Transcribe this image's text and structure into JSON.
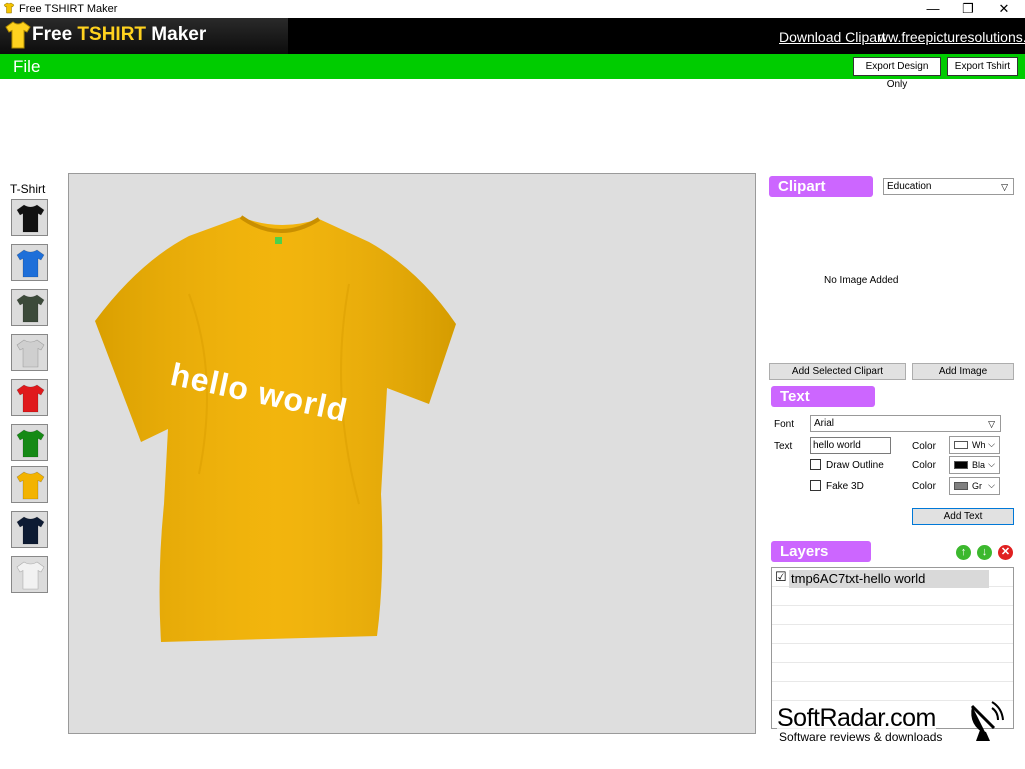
{
  "window": {
    "title": "Free TSHIRT Maker",
    "controls": {
      "minimize": "—",
      "maximize": "❐",
      "close": "✕"
    }
  },
  "banner": {
    "brand_free": "Free ",
    "brand_tshirt": "TSHIRT",
    "brand_maker": " Maker",
    "link_clipart": "Download Clipart",
    "link_site": "ww.freepicturesolutions.co"
  },
  "menu": {
    "file": "File",
    "export_design": "Export Design Only",
    "export_tshirt": "Export Tshirt"
  },
  "left": {
    "label": "T-Shirt",
    "swatch_colors": [
      "#111111",
      "#1e6fd9",
      "#3c4a3a",
      "#cfcfcf",
      "#e0191c",
      "#168a16",
      "#f3b300",
      "#0d1b33",
      "#f2f2f2"
    ]
  },
  "canvas": {
    "shirt_color": "#f2b100",
    "design_text": "hello world"
  },
  "clipart": {
    "header": "Clipart",
    "category": "Education",
    "empty_text": "No Image Added",
    "add_selected": "Add Selected Clipart",
    "add_image": "Add Image"
  },
  "text_panel": {
    "header": "Text",
    "font_label": "Font",
    "font_value": "Arial",
    "text_label": "Text",
    "text_value": "hello world",
    "color_label": "Color",
    "text_color_name": "Wh",
    "text_color": "#ffffff",
    "draw_outline": "Draw Outline",
    "outline_color_name": "Bla",
    "outline_color": "#000000",
    "fake_3d": "Fake 3D",
    "fake3d_color_name": "Gr",
    "fake3d_color": "#808080",
    "add_text": "Add Text"
  },
  "layers": {
    "header": "Layers",
    "items": [
      {
        "name": "tmp6AC7txt-hello world",
        "checked": true
      }
    ]
  },
  "watermark": {
    "title": "SoftRadar.com",
    "subtitle": "Software reviews & downloads"
  },
  "colors": {
    "accent_green": "#00cc00",
    "section_purple": "#cc66ff",
    "brand_yellow": "#ffd21f"
  }
}
